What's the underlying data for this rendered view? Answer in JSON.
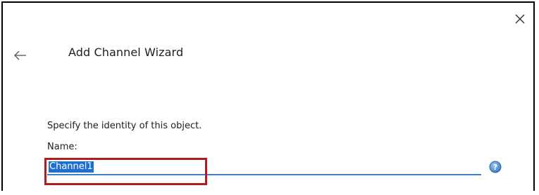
{
  "window": {
    "close_icon": "close-icon",
    "back_icon": "back-arrow-icon"
  },
  "header": {
    "title": "Add Channel Wizard"
  },
  "form": {
    "instruction": "Specify the identity of this object.",
    "name_label": "Name:",
    "name_value": "Channel1",
    "help_icon": "help-icon"
  },
  "colors": {
    "field_underline": "#3b82c4",
    "selection_bg": "#1e6fd0",
    "highlight_box": "#b01d1d",
    "help_icon": "#4a8fd6"
  }
}
